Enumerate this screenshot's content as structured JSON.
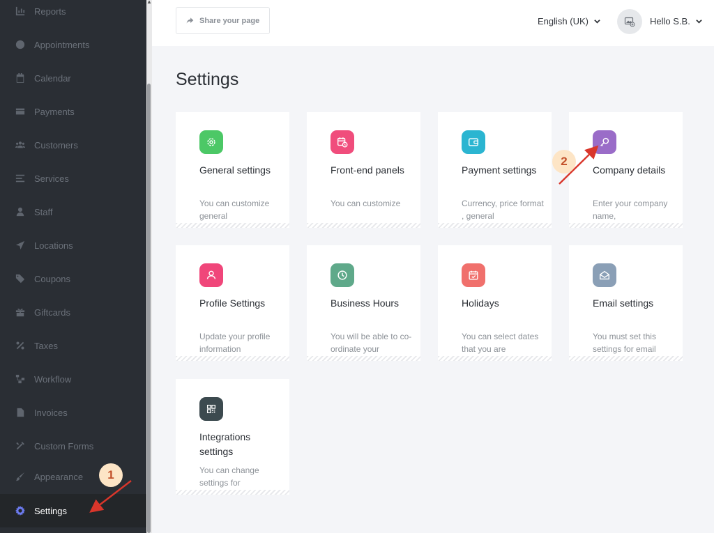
{
  "sidebar": {
    "items": [
      {
        "label": "Reports",
        "icon": "chart-icon"
      },
      {
        "label": "Appointments",
        "icon": "clock-icon"
      },
      {
        "label": "Calendar",
        "icon": "calendar-icon"
      },
      {
        "label": "Payments",
        "icon": "wallet-icon"
      },
      {
        "label": "Customers",
        "icon": "users-icon"
      },
      {
        "label": "Services",
        "icon": "list-icon"
      },
      {
        "label": "Staff",
        "icon": "user-icon"
      },
      {
        "label": "Locations",
        "icon": "location-arrow-icon"
      },
      {
        "label": "Coupons",
        "icon": "tag-icon"
      },
      {
        "label": "Giftcards",
        "icon": "gift-icon"
      },
      {
        "label": "Taxes",
        "icon": "percent-icon"
      },
      {
        "label": "Workflow",
        "icon": "workflow-icon"
      },
      {
        "label": "Invoices",
        "icon": "file-icon"
      },
      {
        "label": "Custom Forms",
        "icon": "tools-icon"
      },
      {
        "label": "Appearance",
        "icon": "brush-icon"
      },
      {
        "label": "Settings",
        "icon": "gear-icon",
        "active": true
      }
    ]
  },
  "topbar": {
    "share_label": "Share your page",
    "language": "English (UK)",
    "user_greeting": "Hello S.B."
  },
  "page": {
    "title": "Settings"
  },
  "cards": [
    {
      "title": "General settings",
      "desc": "You can customize general",
      "icon": "gear-icon",
      "color": "#4cc866"
    },
    {
      "title": "Front-end panels",
      "desc": "You can customize",
      "icon": "calendar-clock-icon",
      "color": "#f04d7c"
    },
    {
      "title": "Payment settings",
      "desc": "Currency, price format , general",
      "icon": "wallet-icon",
      "color": "#2bb5d1"
    },
    {
      "title": "Company details",
      "desc": "Enter your company name,",
      "icon": "key-icon",
      "color": "#9a6cc8"
    },
    {
      "title": "Profile Settings",
      "desc": "Update your profile information",
      "icon": "user-icon",
      "color": "#f0467a"
    },
    {
      "title": "Business Hours",
      "desc": "You will be able to co-ordinate your",
      "icon": "clock-icon",
      "color": "#5fa98a"
    },
    {
      "title": "Holidays",
      "desc": "You can select dates that you are unavailable or on",
      "icon": "calendar-check-icon",
      "color": "#f0706c"
    },
    {
      "title": "Email settings",
      "desc": "You must set this settings for email",
      "icon": "envelope-open-icon",
      "color": "#8a9fb6"
    },
    {
      "title": "Integrations settings",
      "desc": "You can change settings for",
      "icon": "qr-icon",
      "color": "#3c4a4f"
    }
  ],
  "annotations": {
    "step1": "1",
    "step2": "2",
    "badge_fill": "#fde5c6",
    "arrow_color": "#d9362b"
  }
}
